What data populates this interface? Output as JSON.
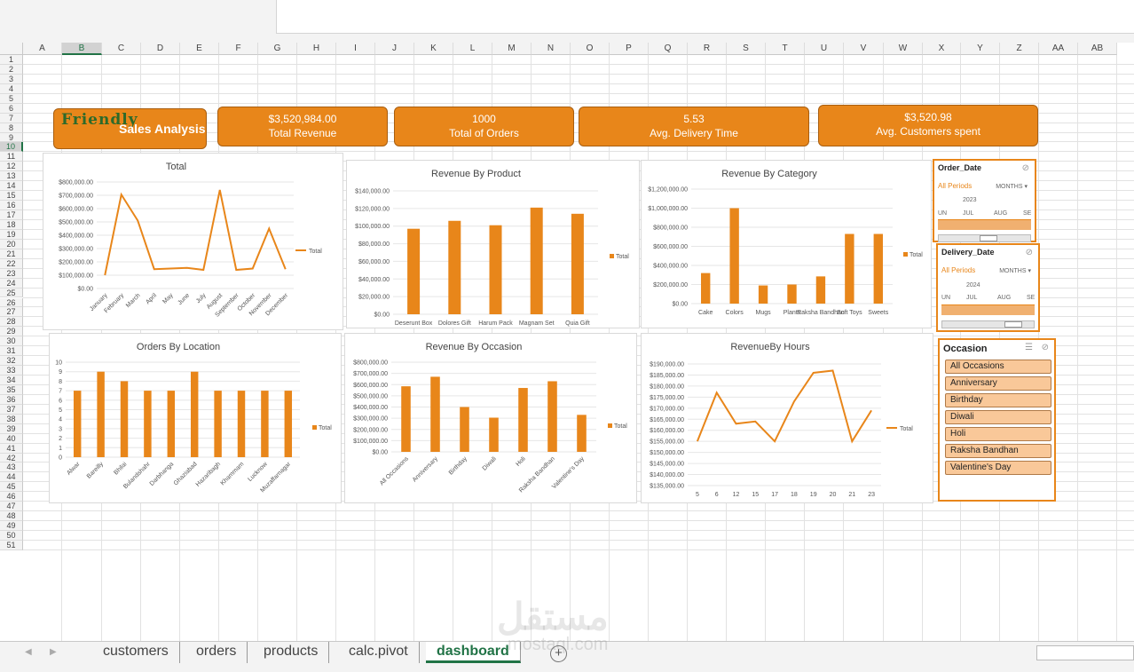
{
  "columns": [
    "A",
    "B",
    "C",
    "D",
    "E",
    "F",
    "G",
    "H",
    "I",
    "J",
    "K",
    "L",
    "M",
    "N",
    "O",
    "P",
    "Q",
    "R",
    "S",
    "T",
    "U",
    "V",
    "W",
    "X",
    "Y",
    "Z",
    "AA",
    "AB"
  ],
  "selected_column": "B",
  "selected_row": "10",
  "rows": [
    "1",
    "2",
    "3",
    "4",
    "5",
    "6",
    "7",
    "8",
    "9",
    "10",
    "11",
    "12",
    "13",
    "14",
    "15",
    "16",
    "17",
    "18",
    "19",
    "20",
    "21",
    "22",
    "23",
    "24",
    "25",
    "26",
    "27",
    "28",
    "29",
    "30",
    "31",
    "32",
    "33",
    "34",
    "35",
    "36",
    "37",
    "38",
    "39",
    "40",
    "41",
    "42",
    "43",
    "44",
    "45",
    "46",
    "47",
    "48",
    "49",
    "50",
    "51"
  ],
  "logo": {
    "word": "Friendly",
    "subtitle": "Sales Analysis"
  },
  "kpis": [
    {
      "value": "$3,520,984.00",
      "label": "Total Revenue"
    },
    {
      "value": "1000",
      "label": "Total of Orders"
    },
    {
      "value": "5.53",
      "label": "Avg. Delivery Time"
    },
    {
      "value": "$3,520.98",
      "label": "Avg. Customers spent"
    }
  ],
  "accent_color": "#e8861a",
  "chart_data": [
    {
      "id": "total",
      "type": "line",
      "title": "Total",
      "legend": "Total",
      "categories": [
        "January",
        "February",
        "March",
        "April",
        "May",
        "June",
        "July",
        "August",
        "September",
        "October",
        "November",
        "December"
      ],
      "values": [
        100000,
        705000,
        510000,
        145000,
        150000,
        155000,
        140000,
        740000,
        140000,
        150000,
        450000,
        145000
      ],
      "ylim": [
        0,
        800000
      ],
      "yticks": [
        "$0.00",
        "$100,000.00",
        "$200,000.00",
        "$300,000.00",
        "$400,000.00",
        "$500,000.00",
        "$600,000.00",
        "$700,000.00",
        "$800,000.00"
      ]
    },
    {
      "id": "product",
      "type": "bar",
      "title": "Revenue By Product",
      "legend": "Total",
      "categories": [
        "Deserunt Box",
        "Dolores Gift",
        "Harum Pack",
        "Magnam Set",
        "Quia Gift"
      ],
      "values": [
        97000,
        106000,
        101000,
        121000,
        114000
      ],
      "ylim": [
        0,
        140000
      ],
      "yticks": [
        "$0.00",
        "$20,000.00",
        "$40,000.00",
        "$60,000.00",
        "$80,000.00",
        "$100,000.00",
        "$120,000.00",
        "$140,000.00"
      ]
    },
    {
      "id": "category",
      "type": "bar",
      "title": "Revenue By Category",
      "legend": "Total",
      "categories": [
        "Cake",
        "Colors",
        "Mugs",
        "Plants",
        "Raksha Bandhan",
        "Soft Toys",
        "Sweets"
      ],
      "values": [
        320000,
        1000000,
        190000,
        200000,
        285000,
        730000,
        730000
      ],
      "ylim": [
        0,
        1200000
      ],
      "yticks": [
        "$0.00",
        "$200,000.00",
        "$400,000.00",
        "$600,000.00",
        "$800,000.00",
        "$1,000,000.00",
        "$1,200,000.00"
      ]
    },
    {
      "id": "location",
      "type": "bar",
      "title": "Orders By Location",
      "legend": "Total",
      "categories": [
        "Alwar",
        "Bareilly",
        "Bhilai",
        "Bulandshahr",
        "Darbhanga",
        "Ghaziabad",
        "Hazaribagh",
        "Khammam",
        "Lucknow",
        "Muzaffarnagar"
      ],
      "values": [
        7,
        9,
        8,
        7,
        7,
        9,
        7,
        7,
        7,
        7
      ],
      "ylim": [
        0,
        10
      ],
      "yticks": [
        "0",
        "1",
        "2",
        "3",
        "4",
        "5",
        "6",
        "7",
        "8",
        "9",
        "10"
      ]
    },
    {
      "id": "occasion",
      "type": "bar",
      "title": "Revenue By Occasion",
      "legend": "Total",
      "categories": [
        "All Occasions",
        "Anniversary",
        "Birthday",
        "Diwali",
        "Holi",
        "Raksha Bandhan",
        "Valentine's Day"
      ],
      "values": [
        585000,
        670000,
        400000,
        305000,
        570000,
        630000,
        330000
      ],
      "ylim": [
        0,
        800000
      ],
      "yticks": [
        "$0.00",
        "$100,000.00",
        "$200,000.00",
        "$300,000.00",
        "$400,000.00",
        "$500,000.00",
        "$600,000.00",
        "$700,000.00",
        "$800,000.00"
      ]
    },
    {
      "id": "hours",
      "type": "line",
      "title": "RevenueBy Hours",
      "legend": "Total",
      "categories": [
        "5",
        "6",
        "12",
        "15",
        "17",
        "18",
        "19",
        "20",
        "21",
        "23"
      ],
      "values": [
        155000,
        177000,
        163000,
        164000,
        155000,
        173000,
        186000,
        187000,
        155000,
        169000
      ],
      "ylim": [
        135000,
        190000
      ],
      "yticks": [
        "$135,000.00",
        "$140,000.00",
        "$145,000.00",
        "$150,000.00",
        "$155,000.00",
        "$160,000.00",
        "$165,000.00",
        "$170,000.00",
        "$175,000.00",
        "$180,000.00",
        "$185,000.00",
        "$190,000.00"
      ]
    }
  ],
  "slicers": {
    "order_date": {
      "title": "Order_Date",
      "period": "All Periods",
      "unit": "MONTHS",
      "year": "2023",
      "months": [
        "UN",
        "JUL",
        "AUG",
        "SE"
      ]
    },
    "delivery_date": {
      "title": "Delivery_Date",
      "period": "All Periods",
      "unit": "MONTHS",
      "year": "2024",
      "months": [
        "UN",
        "JUL",
        "AUG",
        "SE"
      ]
    },
    "occasion": {
      "title": "Occasion",
      "items": [
        "All Occasions",
        "Anniversary",
        "Birthday",
        "Diwali",
        "Holi",
        "Raksha Bandhan",
        "Valentine's Day"
      ]
    }
  },
  "sheet_tabs": [
    "customers",
    "orders",
    "products",
    "calc.pivot",
    "dashboard"
  ],
  "active_tab": "dashboard",
  "watermark": {
    "arabic": "مستقل",
    "latin": "mostaql.com"
  }
}
